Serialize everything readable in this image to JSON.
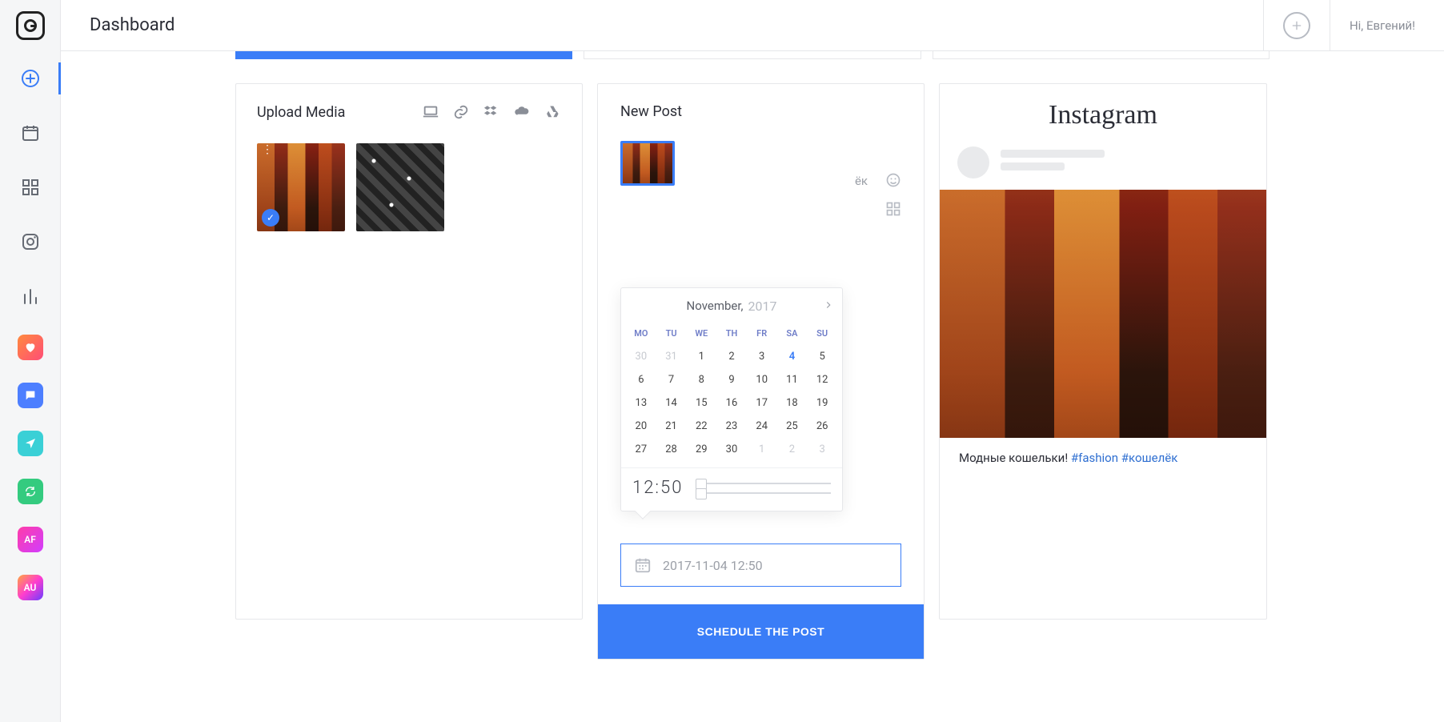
{
  "header": {
    "title": "Dashboard",
    "greeting": "Hi, Евгений!"
  },
  "sidebar": {
    "chips": {
      "af": "AF",
      "au": "AU"
    }
  },
  "upload": {
    "title": "Upload Media"
  },
  "post": {
    "title": "New Post",
    "caption_partial": "ёк",
    "datetime_value": "2017-11-04 12:50",
    "schedule_label": "SCHEDULE THE POST"
  },
  "calendar": {
    "month": "November,",
    "year": "2017",
    "dow": [
      "MO",
      "TU",
      "WE",
      "TH",
      "FR",
      "SA",
      "SU"
    ],
    "days": [
      {
        "n": "30",
        "muted": true
      },
      {
        "n": "31",
        "muted": true
      },
      {
        "n": "1"
      },
      {
        "n": "2"
      },
      {
        "n": "3"
      },
      {
        "n": "4",
        "today": true
      },
      {
        "n": "5"
      },
      {
        "n": "6"
      },
      {
        "n": "7"
      },
      {
        "n": "8"
      },
      {
        "n": "9"
      },
      {
        "n": "10"
      },
      {
        "n": "11"
      },
      {
        "n": "12"
      },
      {
        "n": "13"
      },
      {
        "n": "14"
      },
      {
        "n": "15"
      },
      {
        "n": "16"
      },
      {
        "n": "17"
      },
      {
        "n": "18"
      },
      {
        "n": "19"
      },
      {
        "n": "20"
      },
      {
        "n": "21"
      },
      {
        "n": "22"
      },
      {
        "n": "23"
      },
      {
        "n": "24"
      },
      {
        "n": "25"
      },
      {
        "n": "26"
      },
      {
        "n": "27"
      },
      {
        "n": "28"
      },
      {
        "n": "29"
      },
      {
        "n": "30"
      },
      {
        "n": "1",
        "muted": true
      },
      {
        "n": "2",
        "muted": true
      },
      {
        "n": "3",
        "muted": true
      }
    ],
    "time": "12:50"
  },
  "preview": {
    "brand": "Instagram",
    "caption_text": "Модные кошельки! ",
    "tag1": "#fashion",
    "tag2": "#кошелёк"
  }
}
